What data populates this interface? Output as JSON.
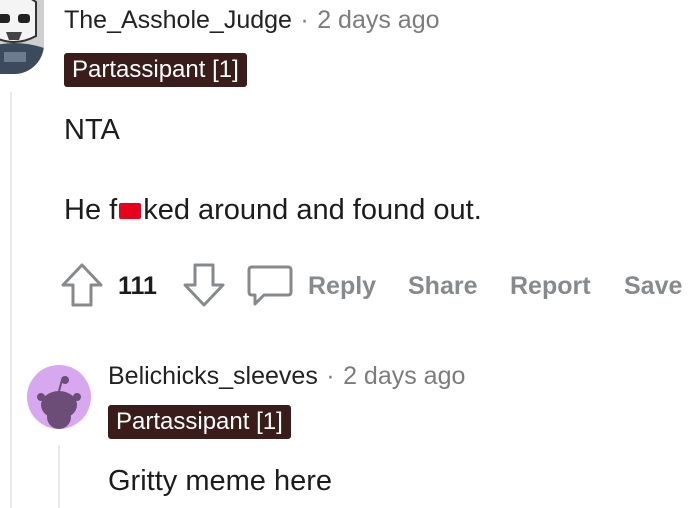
{
  "comment1": {
    "username": "The_Asshole_Judge",
    "separator": "·",
    "timestamp": "2 days ago",
    "flair": "Partassipant [1]",
    "body_line1": "NTA",
    "body_line2_before": "He f",
    "body_line2_after": "ked around and found out.",
    "vote_count": "111",
    "actions": {
      "reply": "Reply",
      "share": "Share",
      "report": "Report",
      "save": "Save"
    }
  },
  "comment2": {
    "username": "Belichicks_sleeves",
    "separator": "·",
    "timestamp": "2 days ago",
    "flair": "Partassipant [1]",
    "body": "Gritty meme here"
  },
  "colors": {
    "flair_bg": "#3a1d1a",
    "redaction": "#e8001c",
    "action_gray": "#878a8c",
    "avatar2_bg": "#d7a8f0"
  }
}
